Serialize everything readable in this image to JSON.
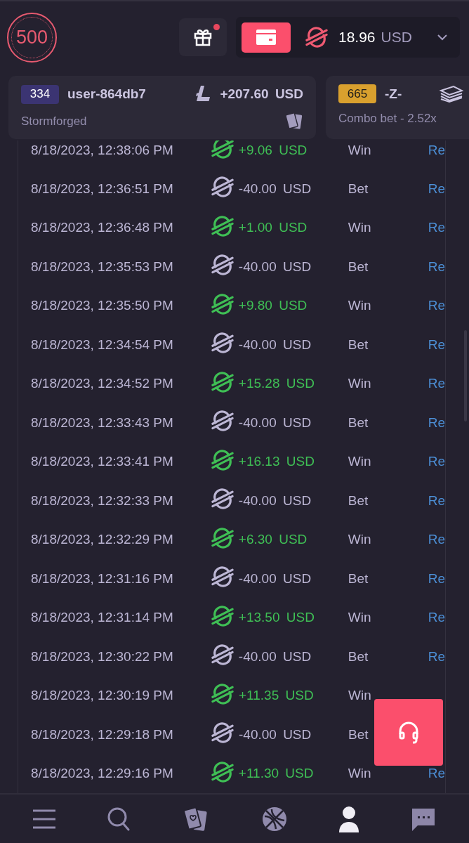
{
  "header": {
    "logo": "500",
    "gift_notification": true,
    "balance": {
      "amount": "18.96",
      "currency": "USD"
    }
  },
  "bets": [
    {
      "badge": "334",
      "color": "#3b3472",
      "user": "user-864db7",
      "amount": "+207.60 USD",
      "caption": "Stormforged"
    },
    {
      "badge": "665",
      "color": "#d9a02e",
      "user": "-Z-",
      "caption": "Combo bet - 2.52x"
    }
  ],
  "transactions": [
    {
      "date": "8/18/2023, 12:38:06 PM",
      "kind": "win",
      "amount": "+9.06 USD",
      "type": "Win",
      "link": "Re"
    },
    {
      "date": "8/18/2023, 12:36:51 PM",
      "kind": "bet",
      "amount": "-40.00 USD",
      "type": "Bet",
      "link": "Re"
    },
    {
      "date": "8/18/2023, 12:36:48 PM",
      "kind": "win",
      "amount": "+1.00 USD",
      "type": "Win",
      "link": "Re"
    },
    {
      "date": "8/18/2023, 12:35:53 PM",
      "kind": "bet",
      "amount": "-40.00 USD",
      "type": "Bet",
      "link": "Re"
    },
    {
      "date": "8/18/2023, 12:35:50 PM",
      "kind": "win",
      "amount": "+9.80 USD",
      "type": "Win",
      "link": "Re"
    },
    {
      "date": "8/18/2023, 12:34:54 PM",
      "kind": "bet",
      "amount": "-40.00 USD",
      "type": "Bet",
      "link": "Re"
    },
    {
      "date": "8/18/2023, 12:34:52 PM",
      "kind": "win",
      "amount": "+15.28 USD",
      "type": "Win",
      "link": "Re"
    },
    {
      "date": "8/18/2023, 12:33:43 PM",
      "kind": "bet",
      "amount": "-40.00 USD",
      "type": "Bet",
      "link": "Re"
    },
    {
      "date": "8/18/2023, 12:33:41 PM",
      "kind": "win",
      "amount": "+16.13 USD",
      "type": "Win",
      "link": "Re"
    },
    {
      "date": "8/18/2023, 12:32:33 PM",
      "kind": "bet",
      "amount": "-40.00 USD",
      "type": "Bet",
      "link": "Re"
    },
    {
      "date": "8/18/2023, 12:32:29 PM",
      "kind": "win",
      "amount": "+6.30 USD",
      "type": "Win",
      "link": "Re"
    },
    {
      "date": "8/18/2023, 12:31:16 PM",
      "kind": "bet",
      "amount": "-40.00 USD",
      "type": "Bet",
      "link": "Re"
    },
    {
      "date": "8/18/2023, 12:31:14 PM",
      "kind": "win",
      "amount": "+13.50 USD",
      "type": "Win",
      "link": "Re"
    },
    {
      "date": "8/18/2023, 12:30:22 PM",
      "kind": "bet",
      "amount": "-40.00 USD",
      "type": "Bet",
      "link": "Re"
    },
    {
      "date": "8/18/2023, 12:30:19 PM",
      "kind": "win",
      "amount": "+11.35 USD",
      "type": "Win"
    },
    {
      "date": "8/18/2023, 12:29:18 PM",
      "kind": "bet",
      "amount": "-40.00 USD",
      "type": "Bet"
    },
    {
      "date": "8/18/2023, 12:29:16 PM",
      "kind": "win",
      "amount": "+11.30 USD",
      "type": "Win",
      "link": "Re"
    }
  ],
  "nav": [
    {
      "kind": "menu",
      "selected": false
    },
    {
      "kind": "search",
      "selected": false
    },
    {
      "kind": "casino",
      "selected": false
    },
    {
      "kind": "sports",
      "selected": false
    },
    {
      "kind": "profile",
      "selected": true
    },
    {
      "kind": "chat",
      "selected": false
    }
  ]
}
